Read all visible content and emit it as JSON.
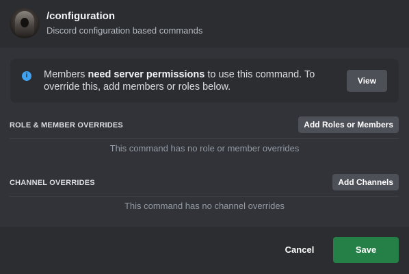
{
  "command": {
    "name": "/configuration",
    "description": "Discord configuration based commands",
    "avatar_icon": "hooded-figure-avatar"
  },
  "notice": {
    "icon": "info-icon",
    "text_before": "Members ",
    "text_bold": "need server permissions",
    "text_after": " to use this command. To override this, add members or roles below.",
    "button_label": "View"
  },
  "role_overrides": {
    "label": "ROLE & MEMBER OVERRIDES",
    "button_label": "Add Roles or Members",
    "empty_text": "This command has no role or member overrides"
  },
  "channel_overrides": {
    "label": "CHANNEL OVERRIDES",
    "button_label": "Add Channels",
    "empty_text": "This command has no channel overrides"
  },
  "footer": {
    "cancel_label": "Cancel",
    "save_label": "Save"
  },
  "colors": {
    "background": "#313338",
    "panel": "#2b2d31",
    "secondary_button": "#4e5058",
    "save_button": "#248046",
    "info_accent": "#3ea2f0"
  }
}
